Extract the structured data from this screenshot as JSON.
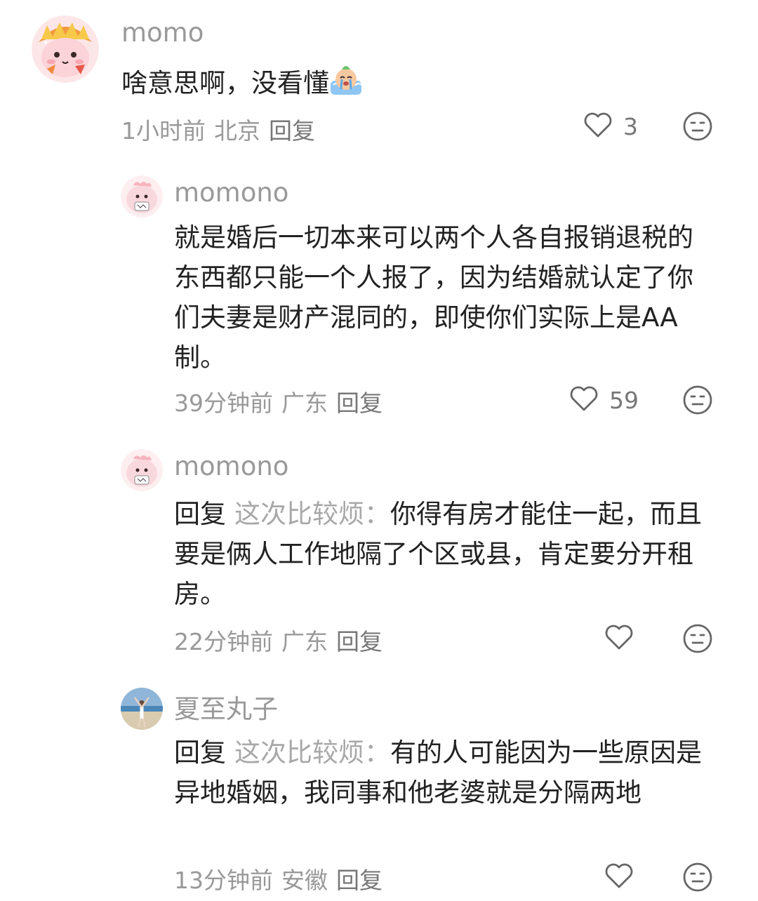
{
  "colors": {
    "text": "#222222",
    "muted": "#999999",
    "reply_target": "#a8a8a8",
    "icon": "#666666"
  },
  "comments": [
    {
      "username": "momo",
      "text": "啥意思啊，没看懂",
      "emoji": "crying-bun-emoji",
      "time": "1小时前",
      "location": "北京",
      "reply_label": "回复",
      "likes": "3",
      "like_icon": "heart-outline-icon",
      "dislike_icon": "meh-face-icon"
    },
    {
      "username": "momono",
      "text": "就是婚后一切本来可以两个人各自报销退税的东西都只能一个人报了，因为结婚就认定了你们夫妻是财产混同的，即使你们实际上是AA制。",
      "time": "39分钟前",
      "location": "广东",
      "reply_label": "回复",
      "likes": "59",
      "like_icon": "heart-outline-icon",
      "dislike_icon": "meh-face-icon"
    },
    {
      "username": "momono",
      "reply_prefix": "回复",
      "reply_to": "这次比较烦",
      "reply_colon": "：",
      "text": "你得有房才能住一起，而且要是俩人工作地隔了个区或县，肯定要分开租房。",
      "time": "22分钟前",
      "location": "广东",
      "reply_label": "回复",
      "likes": "",
      "like_icon": "heart-outline-icon",
      "dislike_icon": "meh-face-icon"
    },
    {
      "username": "夏至丸子",
      "reply_prefix": "回复",
      "reply_to": "这次比较烦",
      "reply_colon": "：",
      "text": "有的人可能因为一些原因是异地婚姻，我同事和他老婆就是分隔两地",
      "time": "13分钟前",
      "location": "安徽",
      "reply_label": "回复",
      "likes": "",
      "like_icon": "heart-outline-icon",
      "dislike_icon": "meh-face-icon"
    }
  ]
}
